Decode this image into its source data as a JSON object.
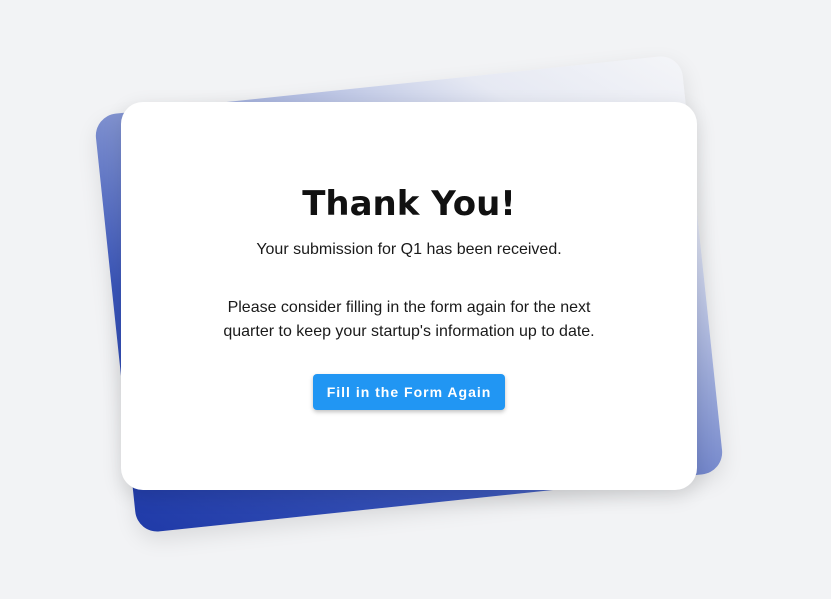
{
  "thank_you": {
    "title": "Thank You!",
    "subtitle": "Your submission for Q1 has been received.",
    "message": "Please consider filling in the form again for the next quarter to keep your startup's information up to date.",
    "button_label": "Fill in the Form Again"
  },
  "colors": {
    "page_background": "#f2f3f5",
    "card_background": "#ffffff",
    "button_background": "#2196f3",
    "accent_blue": "#1f3aa8"
  }
}
